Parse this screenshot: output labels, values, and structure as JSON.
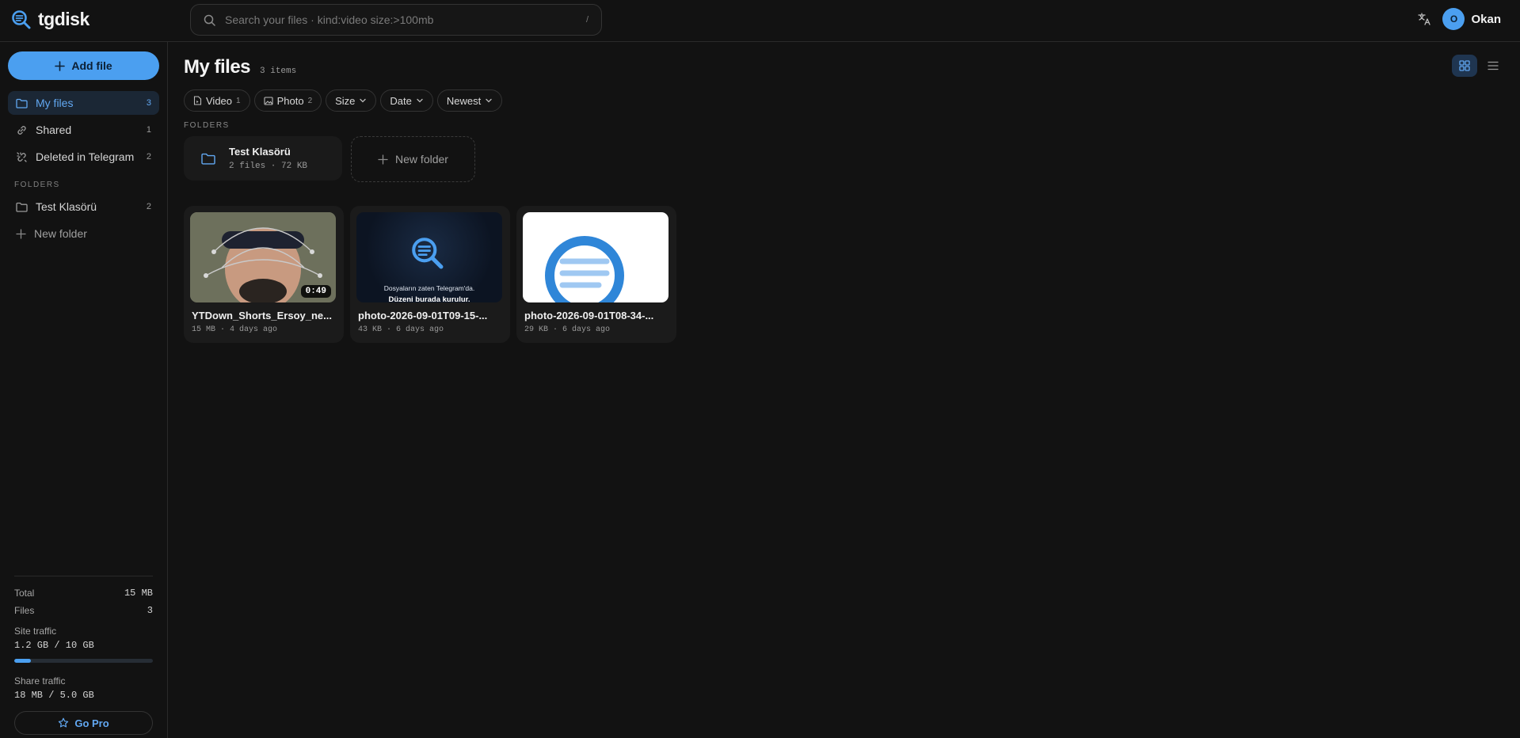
{
  "app": {
    "name": "tgdisk"
  },
  "search": {
    "placeholder": "Search your files · kind:video size:>100mb",
    "shortcut": "/"
  },
  "user": {
    "initial": "O",
    "name": "Okan"
  },
  "sidebar": {
    "add_label": "Add file",
    "items": [
      {
        "label": "My files",
        "count": "3",
        "icon": "folder-icon",
        "active": true
      },
      {
        "label": "Shared",
        "count": "1",
        "icon": "link-icon"
      },
      {
        "label": "Deleted in Telegram",
        "count": "2",
        "icon": "broken-link-icon"
      }
    ],
    "folders_heading": "FOLDERS",
    "folders": [
      {
        "label": "Test Klasörü",
        "count": "2",
        "icon": "folder-icon"
      }
    ],
    "new_folder_label": "New folder",
    "stats": {
      "total_label": "Total",
      "total_value": "15 MB",
      "files_label": "Files",
      "files_value": "3",
      "site_traffic_label": "Site traffic",
      "site_traffic_value": "1.2 GB / 10 GB",
      "site_traffic_fraction": 0.12,
      "share_traffic_label": "Share traffic",
      "share_traffic_value": "18 MB / 5.0 GB"
    },
    "gopro_label": "Go Pro"
  },
  "main": {
    "title": "My files",
    "count": "3 items",
    "filters": [
      {
        "label": "Video",
        "count": "1",
        "icon": "video-file-icon"
      },
      {
        "label": "Photo",
        "count": "2",
        "icon": "image-icon"
      },
      {
        "label": "Size",
        "icon": "chevron-down-icon"
      },
      {
        "label": "Date",
        "icon": "chevron-down-icon"
      },
      {
        "label": "Newest",
        "icon": "chevron-down-icon"
      }
    ],
    "folders_label": "FOLDERS",
    "folder": {
      "name": "Test Klasörü",
      "meta": "2 files · 72 KB"
    },
    "new_folder_label": "New folder",
    "files": [
      {
        "name": "YTDown_Shorts_Ersoy_ne...",
        "meta": "15 MB · 4 days ago",
        "duration": "0:49",
        "type": "video"
      },
      {
        "name": "photo-2026-09-01T09-15-...",
        "meta": "43 KB · 6 days ago",
        "type": "photo",
        "caption1": "Dosyaların zaten Telegram'da.",
        "caption2": "Düzeni burada kurulur."
      },
      {
        "name": "photo-2026-09-01T08-34-...",
        "meta": "29 KB · 6 days ago",
        "type": "photo"
      }
    ]
  },
  "colors": {
    "accent": "#4b9ff0",
    "background": "#121212"
  }
}
